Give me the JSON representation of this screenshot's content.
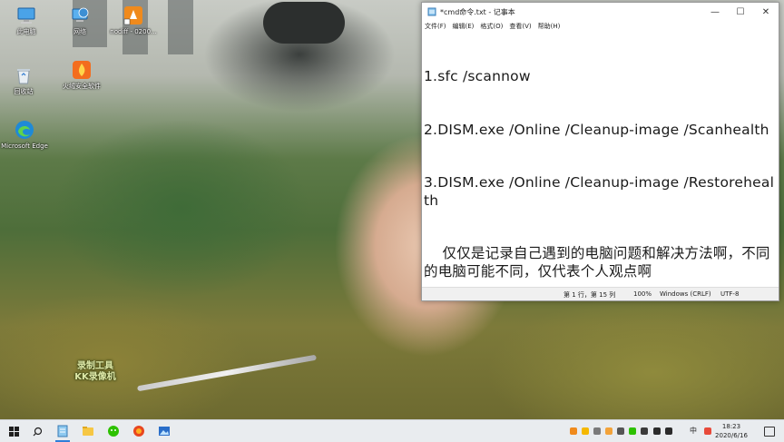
{
  "desktop": {
    "icons": [
      {
        "label": "此电脑",
        "icon": "computer-icon"
      },
      {
        "label": "网络",
        "icon": "network-globe-icon"
      },
      {
        "label": "nodiff - 0200...",
        "icon": "app-shortcut-icon"
      },
      {
        "label": "回收站",
        "icon": "recycle-bin-icon"
      },
      {
        "label": "火绒安全软件",
        "icon": "huorong-security-icon"
      },
      {
        "label": "Microsoft Edge",
        "icon": "edge-icon"
      }
    ],
    "watermark": [
      "录制工具",
      "KK录像机"
    ]
  },
  "notepad": {
    "title": "*cmd命令.txt - 记事本",
    "menu": [
      "文件(F)",
      "编辑(E)",
      "格式(O)",
      "查看(V)",
      "帮助(H)"
    ],
    "lines": [
      "1.sfc /scannow",
      "2.DISM.exe /Online /Cleanup-image /Scanhealth",
      "3.DISM.exe /Online /Cleanup-image /Restorehealth",
      "    仅仅是记录自己遇到的电脑问题和解决方法啊，不同的电脑可能不同，仅代表个人观点啊"
    ],
    "status": {
      "position": "第 1 行，第 15 列",
      "zoom": "100%",
      "line_ending": "Windows (CRLF)",
      "encoding": "UTF-8"
    }
  },
  "taskbar": {
    "apps": [
      "notepad-app",
      "file-explorer-app",
      "wechat-app",
      "browser-app",
      "photo-app"
    ],
    "tray_lang": "中",
    "clock": {
      "time": "18:23",
      "date": "2020/6/16"
    }
  },
  "colors": {
    "accent": "#2f7ed8",
    "taskbar": "#e9ecef",
    "statusbar": "#f0f0f0"
  }
}
